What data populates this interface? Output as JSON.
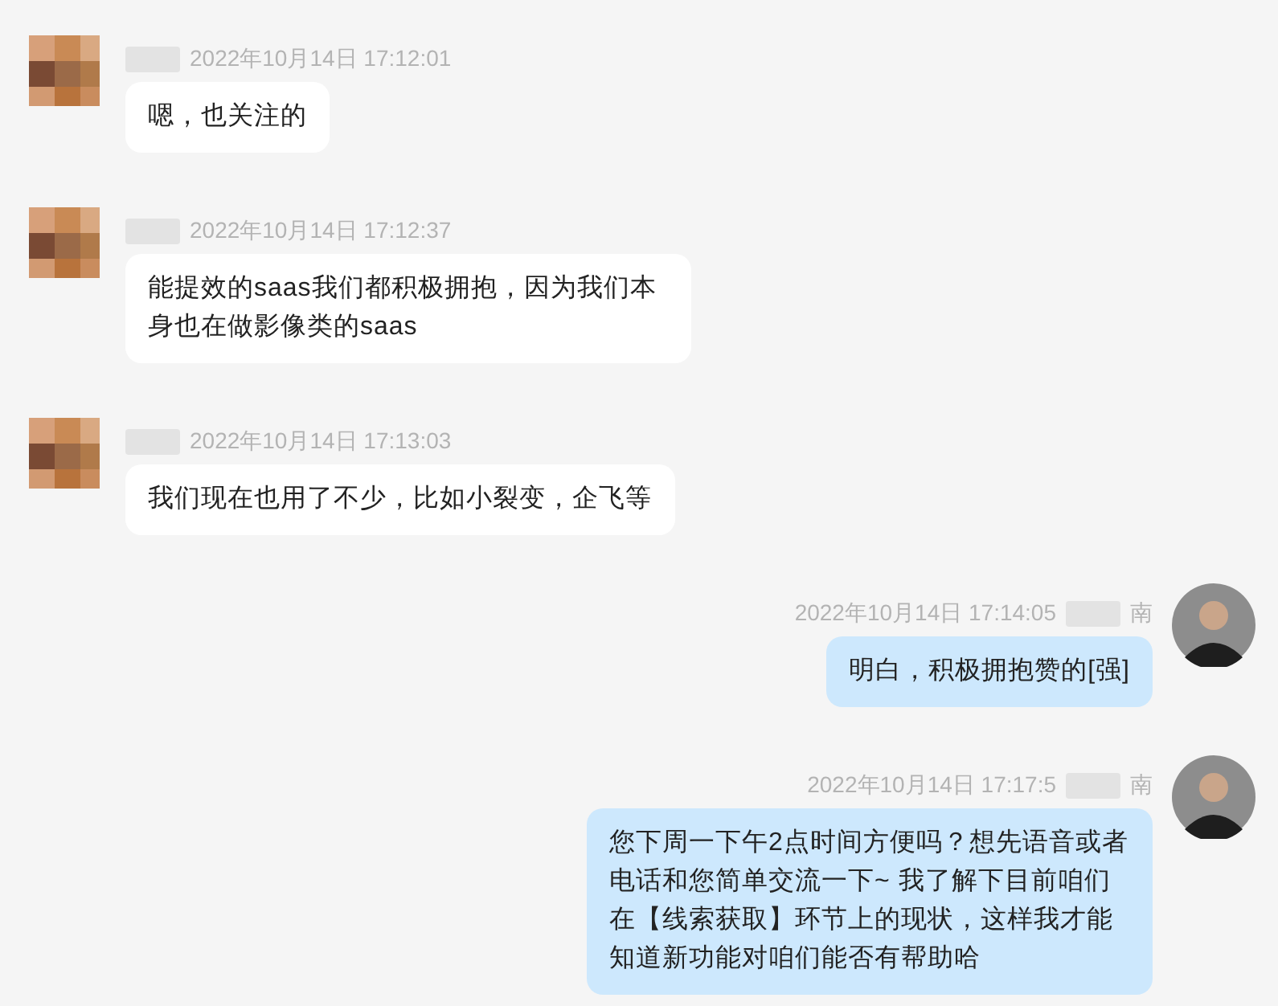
{
  "messages": [
    {
      "outgoing": false,
      "time": "2022年10月14日 17:12:01",
      "text": "嗯，也关注的"
    },
    {
      "outgoing": false,
      "time": "2022年10月14日 17:12:37",
      "text": "能提效的saas我们都积极拥抱，因为我们本身也在做影像类的saas"
    },
    {
      "outgoing": false,
      "time": "2022年10月14日 17:13:03",
      "text": "我们现在也用了不少，比如小裂变，企飞等"
    },
    {
      "outgoing": true,
      "time": "2022年10月14日 17:14:05",
      "name": "南",
      "text": "明白，积极拥抱赞的[强]"
    },
    {
      "outgoing": true,
      "time": "2022年10月14日 17:17:5",
      "name": "南",
      "text": "您下周一下午2点时间方便吗？想先语音或者电话和您简单交流一下~ 我了解下目前咱们在【线索获取】环节上的现状，这样我才能知道新功能对咱们能否有帮助哈"
    }
  ]
}
